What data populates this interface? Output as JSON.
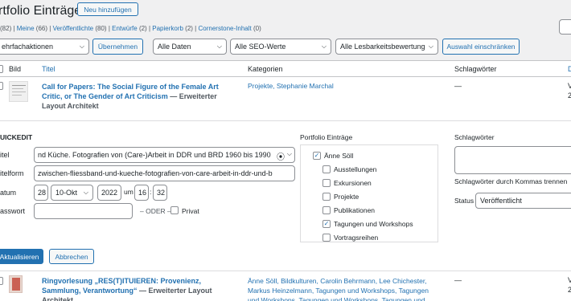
{
  "header": {
    "title": "rtfolio Einträge",
    "add_new": "Neu hinzufügen"
  },
  "views": [
    {
      "label": "(82)",
      "sep": " | "
    },
    {
      "label": "Meine",
      "count": "(66)",
      "sep": " | "
    },
    {
      "label": "Veröffentlichte",
      "count": "(80)",
      "sep": " | "
    },
    {
      "label": "Entwürfe",
      "count": "(2)",
      "sep": " | "
    },
    {
      "label": "Papierkorb",
      "count": "(2)",
      "sep": " | "
    },
    {
      "label": "Cornerstone-Inhalt",
      "count": "(0)",
      "sep": ""
    }
  ],
  "filters": {
    "bulk": "ehrfachaktionen",
    "apply": "Übernehmen",
    "dates": "Alle Daten",
    "seo": "Alle SEO-Werte",
    "readability": "Alle Lesbarkeitsbewertung",
    "restrict": "Auswahl einschränken"
  },
  "columns": {
    "image": "Bild",
    "title": "Titel",
    "categories": "Kategorien",
    "tags": "Schlagwörter",
    "cut": "D"
  },
  "row1": {
    "title": "Call for Papers: The Social Figure of the Female Art Critic, or The Gender of Art Criticism",
    "suffix": " — Erweiterter Layout Architekt",
    "categories": "Projekte, Stephanie Marchal",
    "tags": "—",
    "cut1": "V",
    "cut2": "2"
  },
  "quickedit": {
    "heading": "UICKEDIT",
    "title_label": "itel",
    "title_value": "nd Küche. Fotografien von (Care-)Arbeit in DDR und BRD 1960 bis 1990",
    "slug_label": "itelform",
    "slug_value": "zwischen-fliessband-und-kueche-fotografien-von-care-arbeit-in-ddr-und-b",
    "date_label": "atum",
    "day": "28",
    "month": "10-Okt",
    "year": "2022",
    "um": "um",
    "hour": "16",
    "minute": "32",
    "password_label": "asswort",
    "password_value": "",
    "oder": "– ODER –",
    "private": "Privat",
    "cats_heading": "Portfolio Einträge",
    "cats": [
      {
        "label": "Änne Söll",
        "checked": true,
        "indent": false
      },
      {
        "label": "Ausstellungen",
        "checked": false,
        "indent": true
      },
      {
        "label": "Exkursionen",
        "checked": false,
        "indent": true
      },
      {
        "label": "Projekte",
        "checked": false,
        "indent": true
      },
      {
        "label": "Publikationen",
        "checked": false,
        "indent": true
      },
      {
        "label": "Tagungen und Workshops",
        "checked": true,
        "indent": true
      },
      {
        "label": "Vortragsreihen",
        "checked": false,
        "indent": true
      }
    ],
    "tags_heading": "Schlagwörter",
    "tags_hint": "Schlagwörter durch Kommas trennen",
    "status_label": "Status",
    "status_value": "Veröffentlicht",
    "update": "Aktualisieren",
    "cancel": "Abbrechen"
  },
  "row2": {
    "title": "Ringvorlesung „RES(T)ITUIEREN: Provenienz, Sammlung, Verantwortung“",
    "suffix": " — Erweiterter Layout Architekt",
    "categories": "Änne Söll, Bildkulturen, Carolin Behrmann, Lee Chichester, Markus Heinzelmann, Tagungen und Workshops, Tagungen und Workshops, Tagungen und Workshops, Tagungen und",
    "tags": "—",
    "cut1": "V",
    "cut2": "2"
  }
}
